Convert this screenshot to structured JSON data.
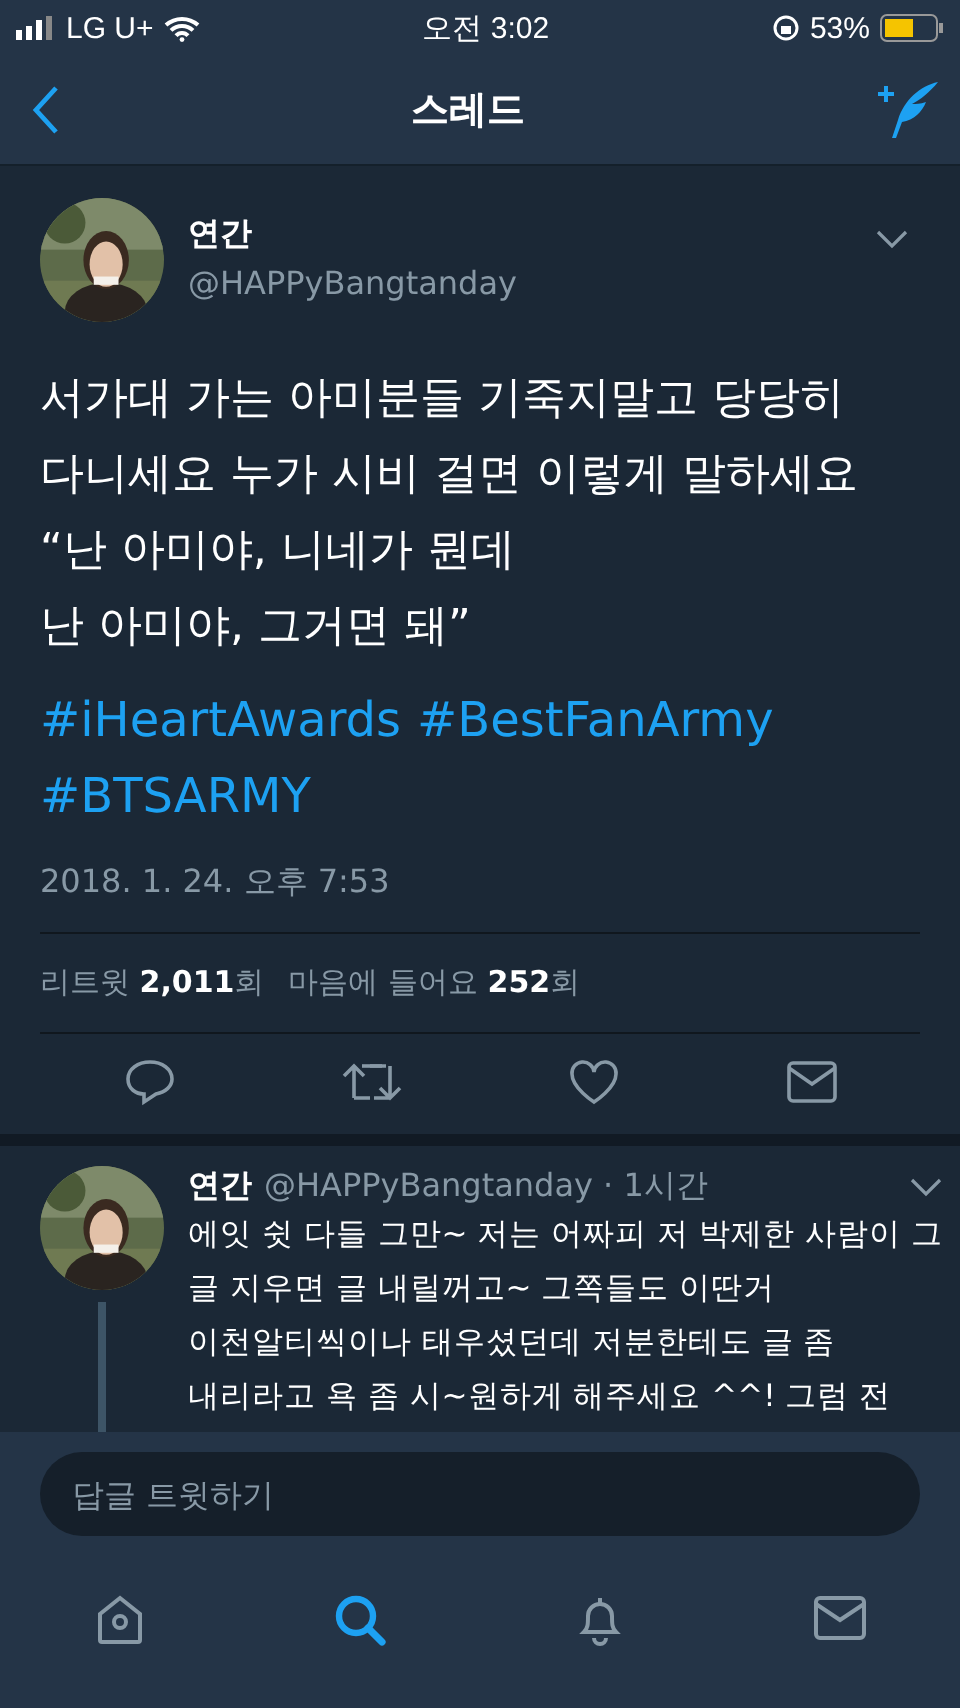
{
  "status_bar": {
    "carrier": "LG U+",
    "time": "오전 3:02",
    "battery": "53%"
  },
  "nav": {
    "title": "스레드"
  },
  "tweet": {
    "name": "연간",
    "handle": "@HAPPyBangtanday",
    "text_lines": [
      "서가대 가는 아미분들 기죽지말고 당당히",
      "다니세요 누가 시비 걸면 이렇게 말하세요",
      "“난 아미야, 니네가 뭔데",
      "      난 아미야, 그거면 돼”"
    ],
    "hashtags": [
      "#iHeartAwards",
      "#BestFanArmy",
      "#BTSARMY"
    ],
    "timestamp": "2018. 1. 24. 오후 7:53",
    "stats": [
      "리트윗 **2,011**회",
      "마음에 들어요 **252**회"
    ]
  },
  "reply": {
    "name": "연간",
    "handle": "@HAPPyBangtanday · 1시간",
    "text_lines": [
      "에잇 쉿 다들 그만~ 저는 어짜피 저 박제한 사람이 그",
      "글 지우면 글 내릴꺼고~ 그쪽들도 이딴거",
      "이천알티씩이나 태우셨던데 저분한테도 글 좀",
      "내리라고 욕 좀 시~원하게 해주세요 ^^! 그럼 전"
    ]
  },
  "composer": {
    "placeholder": "답글 트윗하기"
  },
  "tab_bar": [
    {
      "kind": "home",
      "selected": false
    },
    {
      "kind": "search",
      "selected": true
    },
    {
      "kind": "notifications",
      "selected": false
    },
    {
      "kind": "messages",
      "selected": false
    }
  ]
}
